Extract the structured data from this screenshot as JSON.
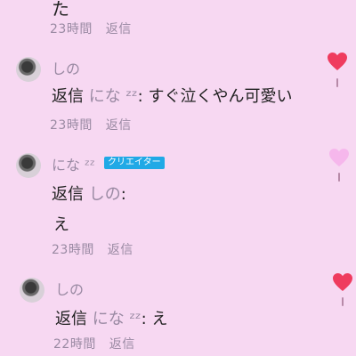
{
  "top_fragment": "た",
  "comments": [
    {
      "time": "23時間",
      "reply": "返信"
    },
    {
      "author": "しの",
      "text_prefix": "返信",
      "mention": "にな ᶻᶻ",
      "colon": ":",
      "text": "すぐ泣くやん可愛い",
      "time": "23時間",
      "reply": "返信",
      "liked": true
    },
    {
      "author": "にな ᶻᶻ",
      "badge": "クリエイター",
      "text_prefix": "返信",
      "mention": "しの",
      "colon": ":",
      "text": "え",
      "time": "23時間",
      "reply": "返信",
      "liked": false
    },
    {
      "author": "しの",
      "text_prefix": "返信",
      "mention": "にな ᶻᶻ",
      "colon": ":",
      "text": "え",
      "time": "22時間",
      "reply": "返信",
      "liked": true
    }
  ],
  "colors": {
    "background": "#f7d8f2",
    "heart_liked": "#ef3b5e",
    "heart_unliked": "#f6b7ec",
    "badge": "#20a9e6",
    "muted_text": "#9a8aa3"
  },
  "icons": {
    "heart": "heart-icon",
    "avatar": "avatar-image"
  }
}
